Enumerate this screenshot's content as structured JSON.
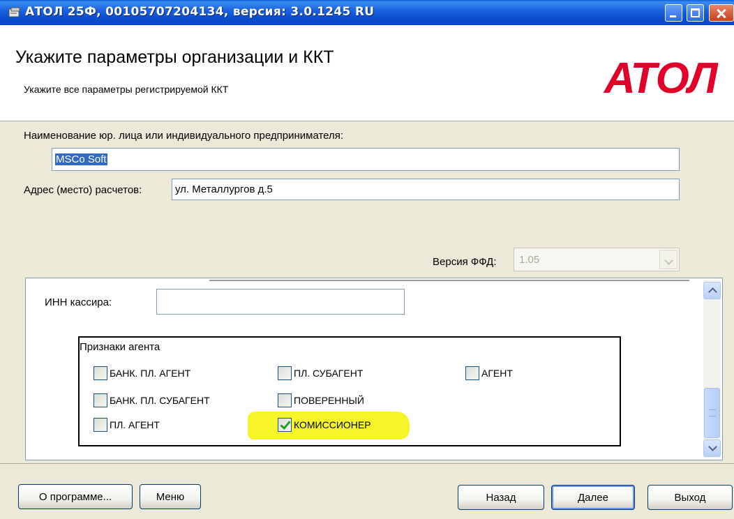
{
  "window": {
    "title": "АТОЛ 25Ф, 00105707204134, версия: 3.0.1245 RU"
  },
  "header": {
    "title": "Укажите параметры организации и ККТ",
    "subtitle": "Укажите все параметры регистрируемой ККТ",
    "logo": "АТОЛ",
    "brand_color": "#e0002a"
  },
  "form": {
    "org_name_label": "Наименование юр. лица или индивидуального предпринимателя:",
    "org_name_value": "MSCo Soft",
    "address_label": "Адрес (место) расчетов:",
    "address_value": "ул. Металлургов д.5",
    "ffd_label": "Версия ФФД:",
    "ffd_value": "1.05",
    "inn_label": "ИНН кассира:",
    "inn_value": ""
  },
  "agent_group": {
    "title": "Признаки агента",
    "items": [
      {
        "label": "БАНК. ПЛ. АГЕНТ",
        "checked": false
      },
      {
        "label": "ПЛ. СУБАГЕНТ",
        "checked": false
      },
      {
        "label": "АГЕНТ",
        "checked": false
      },
      {
        "label": "БАНК. ПЛ. СУБАГЕНТ",
        "checked": false
      },
      {
        "label": "ПОВЕРЕННЫЙ",
        "checked": false
      },
      {
        "label": "ПЛ. АГЕНТ",
        "checked": false
      },
      {
        "label": "КОМИССИОНЕР",
        "checked": true
      }
    ],
    "highlight_color": "#f6f52a"
  },
  "buttons": {
    "about": "О программе...",
    "menu": "Меню",
    "back": "Назад",
    "next": "Далее",
    "exit": "Выход"
  }
}
